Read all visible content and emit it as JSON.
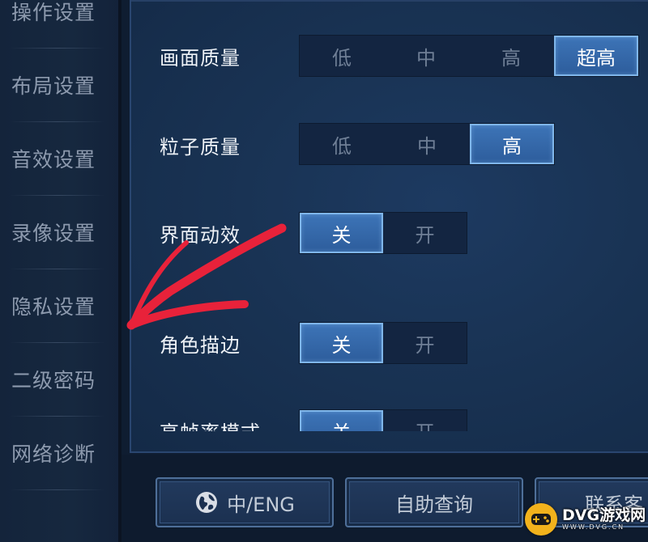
{
  "sidebar": {
    "items": [
      {
        "label": "操作设置"
      },
      {
        "label": "布局设置"
      },
      {
        "label": "音效设置"
      },
      {
        "label": "录像设置"
      },
      {
        "label": "隐私设置"
      },
      {
        "label": "二级密码"
      },
      {
        "label": "网络诊断"
      }
    ]
  },
  "settings": {
    "rows": [
      {
        "label": "画面质量",
        "options": [
          "低",
          "中",
          "高",
          "超高"
        ],
        "selected": "超高"
      },
      {
        "label": "粒子质量",
        "options": [
          "低",
          "中",
          "高"
        ],
        "selected": "高"
      },
      {
        "label": "界面动效",
        "options": [
          "关",
          "开"
        ],
        "selected": "关"
      },
      {
        "label": "角色描边",
        "options": [
          "关",
          "开"
        ],
        "selected": "关"
      },
      {
        "label": "高帧率模式",
        "options": [
          "关",
          "开"
        ],
        "selected": "关"
      }
    ]
  },
  "bottom_buttons": {
    "language": "中/ENG",
    "self_help": "自助查询",
    "contact": "联系客"
  },
  "colors": {
    "active_option": "#3d74b7",
    "annotation_arrow": "#e8223a",
    "watermark_logo": "#f2b21c"
  },
  "icons": {
    "language_button": "globe-icon"
  },
  "watermark": {
    "brand": "DVG游戏网",
    "url": "WWW.DVG.CN"
  }
}
